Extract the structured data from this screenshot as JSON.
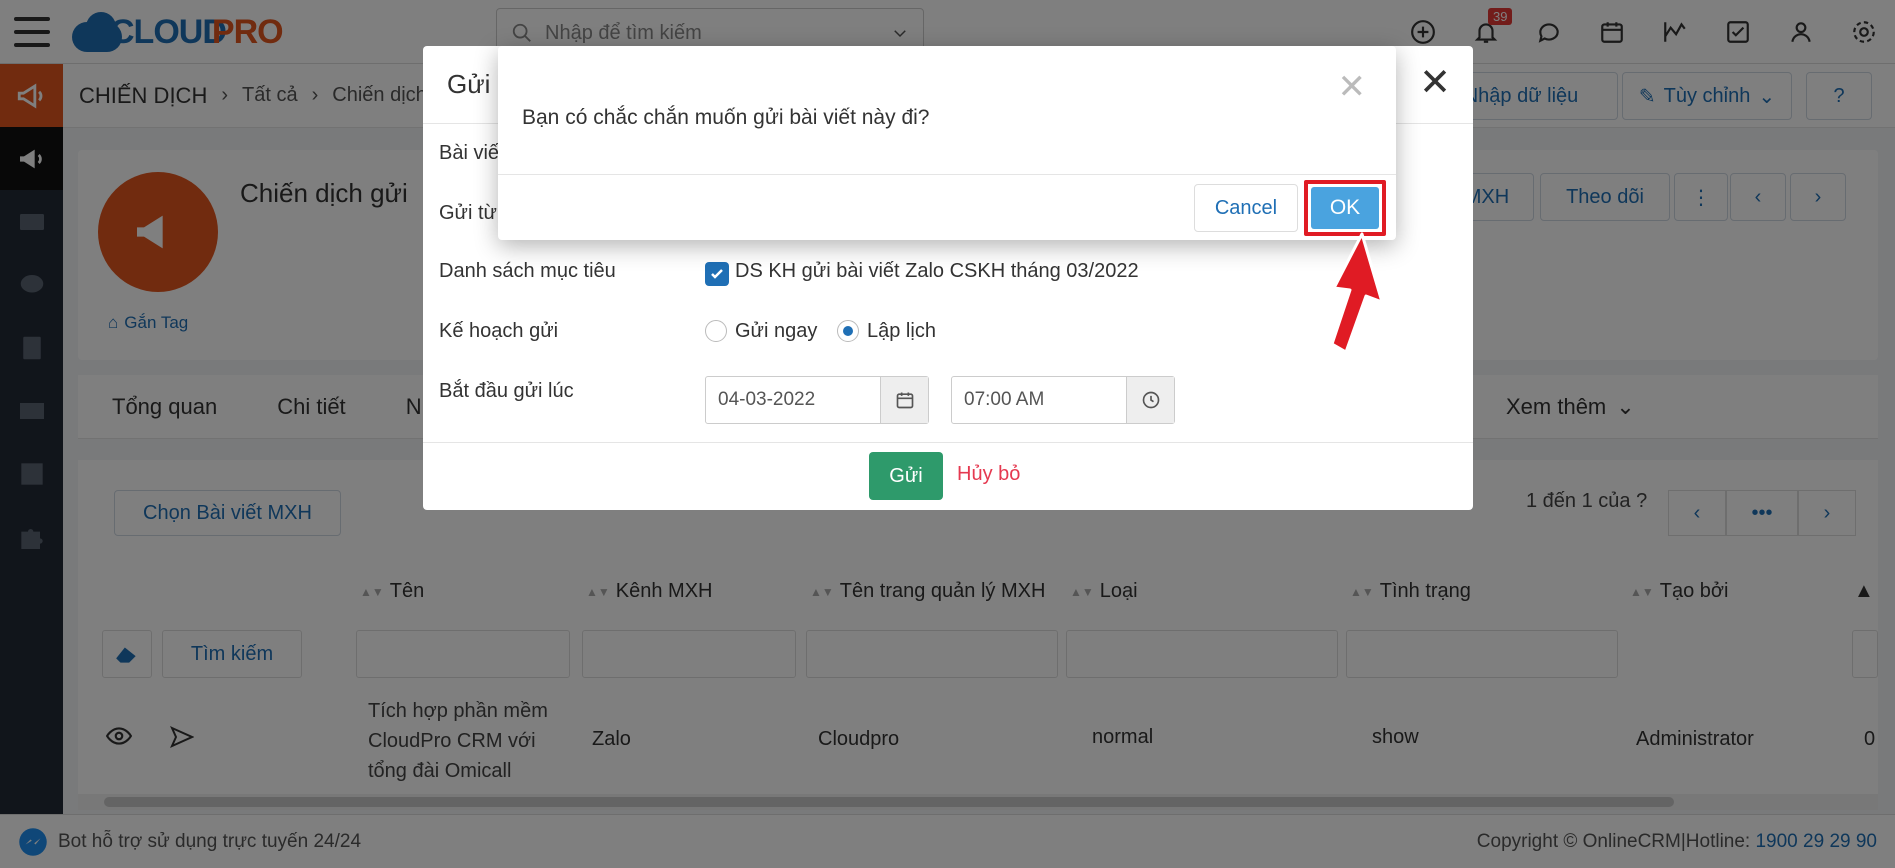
{
  "app": {
    "logo_part1": "CLOUD",
    "logo_part2": "PRO",
    "search_placeholder": "Nhập để tìm kiếm",
    "notification_count": "39"
  },
  "breadcrumb": {
    "root": "CHIẾN DỊCH",
    "level1": "Tất cả",
    "level2": "Chiến dịch g",
    "import_label": "Nhập dữ liệu",
    "customize_label": "Tùy chỉnh"
  },
  "header": {
    "title": "Chiến dịch gửi",
    "tag_label": "Gắn Tag",
    "mxh_label": "MXH",
    "follow_label": "Theo dõi"
  },
  "tabs": {
    "items": [
      "Tổng quan",
      "Chi tiết",
      "Nhậ"
    ],
    "more": "Xem thêm"
  },
  "list": {
    "choose_button": "Chọn Bài viết MXH",
    "pager_text": "1 đến 1 của",
    "pager_help": "?",
    "columns": [
      "Tên",
      "Kênh MXH",
      "Tên trang quản lý MXH",
      "Loại",
      "Tình trạng",
      "Tạo bởi"
    ],
    "search_button": "Tìm kiếm",
    "row": {
      "name_line1": "Tích hợp phần mềm",
      "name_line2": "CloudPro CRM với",
      "name_line3": "tổng đài Omicall",
      "channel": "Zalo",
      "page": "Cloudpro",
      "type": "normal",
      "status": "show",
      "created_by": "Administrator",
      "extra": "0"
    }
  },
  "send_modal": {
    "title": "Gửi",
    "label_post": "Bài viết",
    "label_from": "Gửi từ",
    "label_target": "Danh sách mục tiêu",
    "target_value": "DS KH gửi bài viết Zalo CSKH tháng 03/2022",
    "label_plan": "Kế hoạch gửi",
    "plan_now": "Gửi ngay",
    "plan_schedule": "Lập lịch",
    "label_start": "Bắt đầu gửi lúc",
    "date_value": "04-03-2022",
    "time_value": "07:00 AM",
    "send_button": "Gửi",
    "cancel_link": "Hủy bỏ"
  },
  "confirm": {
    "message": "Bạn có chắc chắn muốn gửi bài viết này đi?",
    "cancel": "Cancel",
    "ok": "OK"
  },
  "footer": {
    "bot_text": "Bot hỗ trợ sử dụng trực tuyến 24/24",
    "copyright": "Copyright © OnlineCRM|Hotline: ",
    "hotline": "1900 29 29 90"
  },
  "colors": {
    "brand_blue": "#1f6fb5",
    "brand_orange": "#e2561f",
    "ok_blue": "#4aa3df",
    "highlight_red": "#e01b24",
    "send_green": "#2e9a6b"
  }
}
